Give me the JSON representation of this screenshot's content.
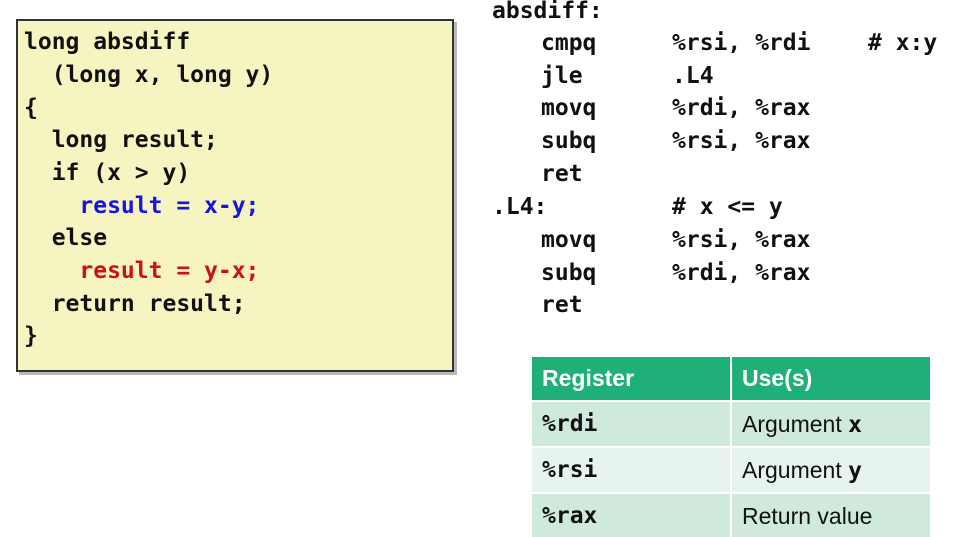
{
  "c_code": {
    "lines": [
      "long absdiff",
      "  (long x, long y)",
      "{",
      "  long result;",
      "  if (x > y)",
      "    result = x-y;",
      "  else",
      "    result = y-x;",
      "  return result;",
      "}"
    ]
  },
  "asm": {
    "label_main": "absdiff:",
    "rows": [
      {
        "op": "cmpq",
        "args": "%rsi, %rdi",
        "comment": "# x:y"
      },
      {
        "op": "jle",
        "args": ".L4",
        "comment": ""
      },
      {
        "op": "movq",
        "args": "%rdi, %rax",
        "comment": ""
      },
      {
        "op": "subq",
        "args": "%rsi, %rax",
        "comment": ""
      },
      {
        "op": "ret",
        "args": "",
        "comment": ""
      }
    ],
    "label_l4": ".L4:",
    "label_l4_comment": "# x <= y",
    "rows2": [
      {
        "op": "movq",
        "args": "%rsi, %rax"
      },
      {
        "op": "subq",
        "args": "%rdi, %rax"
      },
      {
        "op": "ret",
        "args": ""
      }
    ]
  },
  "register_table": {
    "headers": [
      "Register",
      "Use(s)"
    ],
    "rows": [
      {
        "register": "%rdi",
        "use_prefix": "Argument ",
        "use_arg": "x"
      },
      {
        "register": "%rsi",
        "use_prefix": "Argument ",
        "use_arg": "y"
      },
      {
        "register": "%rax",
        "use_prefix": "Return value",
        "use_arg": ""
      }
    ]
  },
  "colors": {
    "code_box_bg": "#f6f4c0",
    "blue_highlight": "#1414e6",
    "red_highlight": "#cc1111",
    "table_header": "#1fb07a"
  }
}
